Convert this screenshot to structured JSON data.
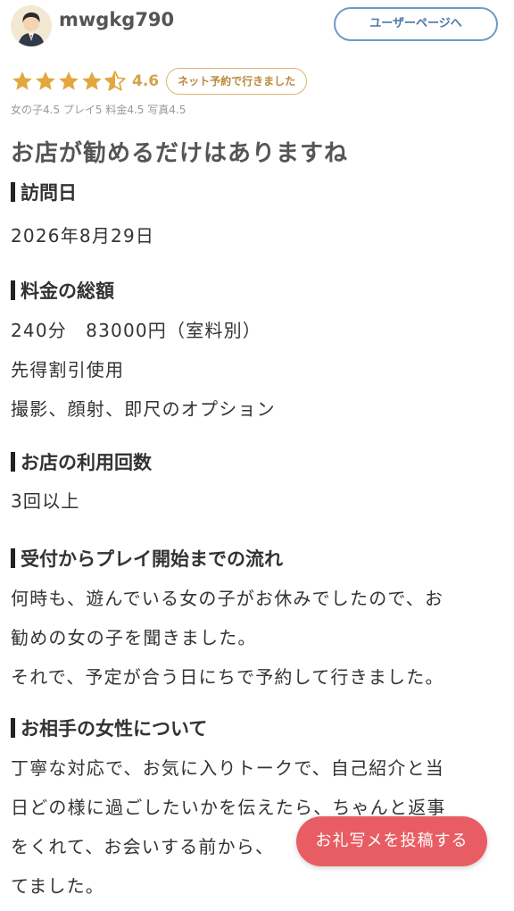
{
  "header": {
    "username": "mwgkg790",
    "user_page_button_label": "ユーザーページへ"
  },
  "rating": {
    "stars": 4.5,
    "value": "4.6",
    "badge": "ネット予約で行きました",
    "sub_ratings": "女の子4.5 プレイ5 料金4.5 写真4.5"
  },
  "review": {
    "title": "お店が勧めるだけはありますね",
    "sections": {
      "visit": {
        "heading": "訪問日",
        "lines": [
          "2026年8月29日"
        ]
      },
      "price": {
        "heading": "料金の総額",
        "lines": [
          "240分　83000円（室料別）",
          "先得割引使用",
          "撮影、顔射、即尺のオプション"
        ]
      },
      "visits_count": {
        "heading": "お店の利用回数",
        "lines": [
          "3回以上"
        ]
      },
      "flow": {
        "heading": "受付からプレイ開始までの流れ",
        "lines": [
          "何時も、遊んでいる女の子がお休みでしたので、お",
          "勧めの女の子を聞きました。",
          "それで、予定が合う日にちで予約して行きました。"
        ]
      },
      "partner": {
        "heading": "お相手の女性について",
        "lines": [
          "丁寧な対応で、お気に入りトークで、自己紹介と当",
          "日どの様に過ごしたいかを伝えたら、ちゃんと返事",
          "をくれて、お会いする前から、",
          "てました。"
        ]
      }
    }
  },
  "floating": {
    "post_thanks_label": "お礼写メを投稿する"
  },
  "colors": {
    "star": "#e3a73e",
    "accent_button": "#e85d63",
    "user_button_border": "#6c9ac8"
  },
  "icons": {
    "avatar": "user-avatar-icon",
    "star": "star-icon",
    "heading_marker": "vertical-bar"
  }
}
